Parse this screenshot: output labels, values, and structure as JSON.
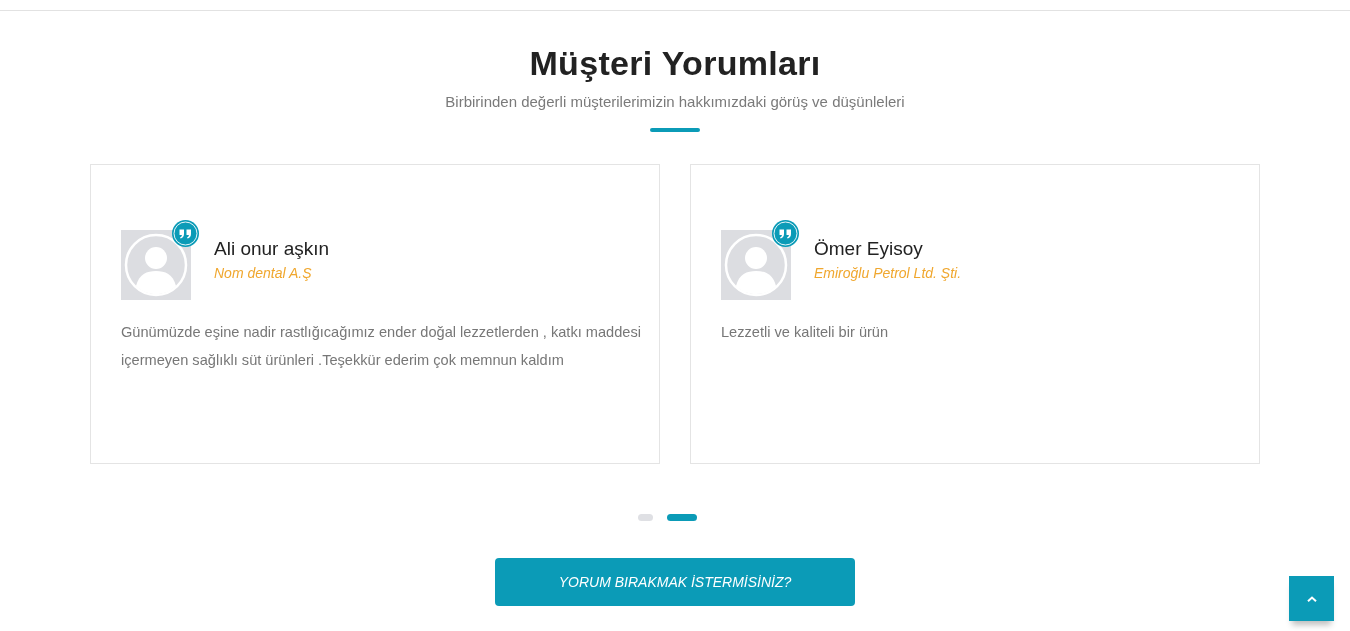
{
  "section": {
    "title": "Müşteri Yorumları",
    "subtitle": "Birbirinden değerli müşterilerimizin hakkımızdaki görüş ve düşünleleri"
  },
  "testimonials": [
    {
      "name": "Ali onur aşkın",
      "company": "Nom dental A.Ş",
      "text": "Günümüzde eşine nadir rastlığıcağımız ender doğal lezzetlerden , katkı maddesi içermeyen sağlıklı süt ürünleri .Teşekkür ederim çok memnun kaldım"
    },
    {
      "name": "Ömer Eyisoy",
      "company": "Emiroğlu Petrol Ltd. Şti.",
      "text": "Lezzetli ve kaliteli bir ürün"
    }
  ],
  "pagination": [
    {
      "selected": false
    },
    {
      "selected": true
    }
  ],
  "cta_button": {
    "label": "YORUM BIRAKMAK İSTERMİSİNİZ?"
  }
}
